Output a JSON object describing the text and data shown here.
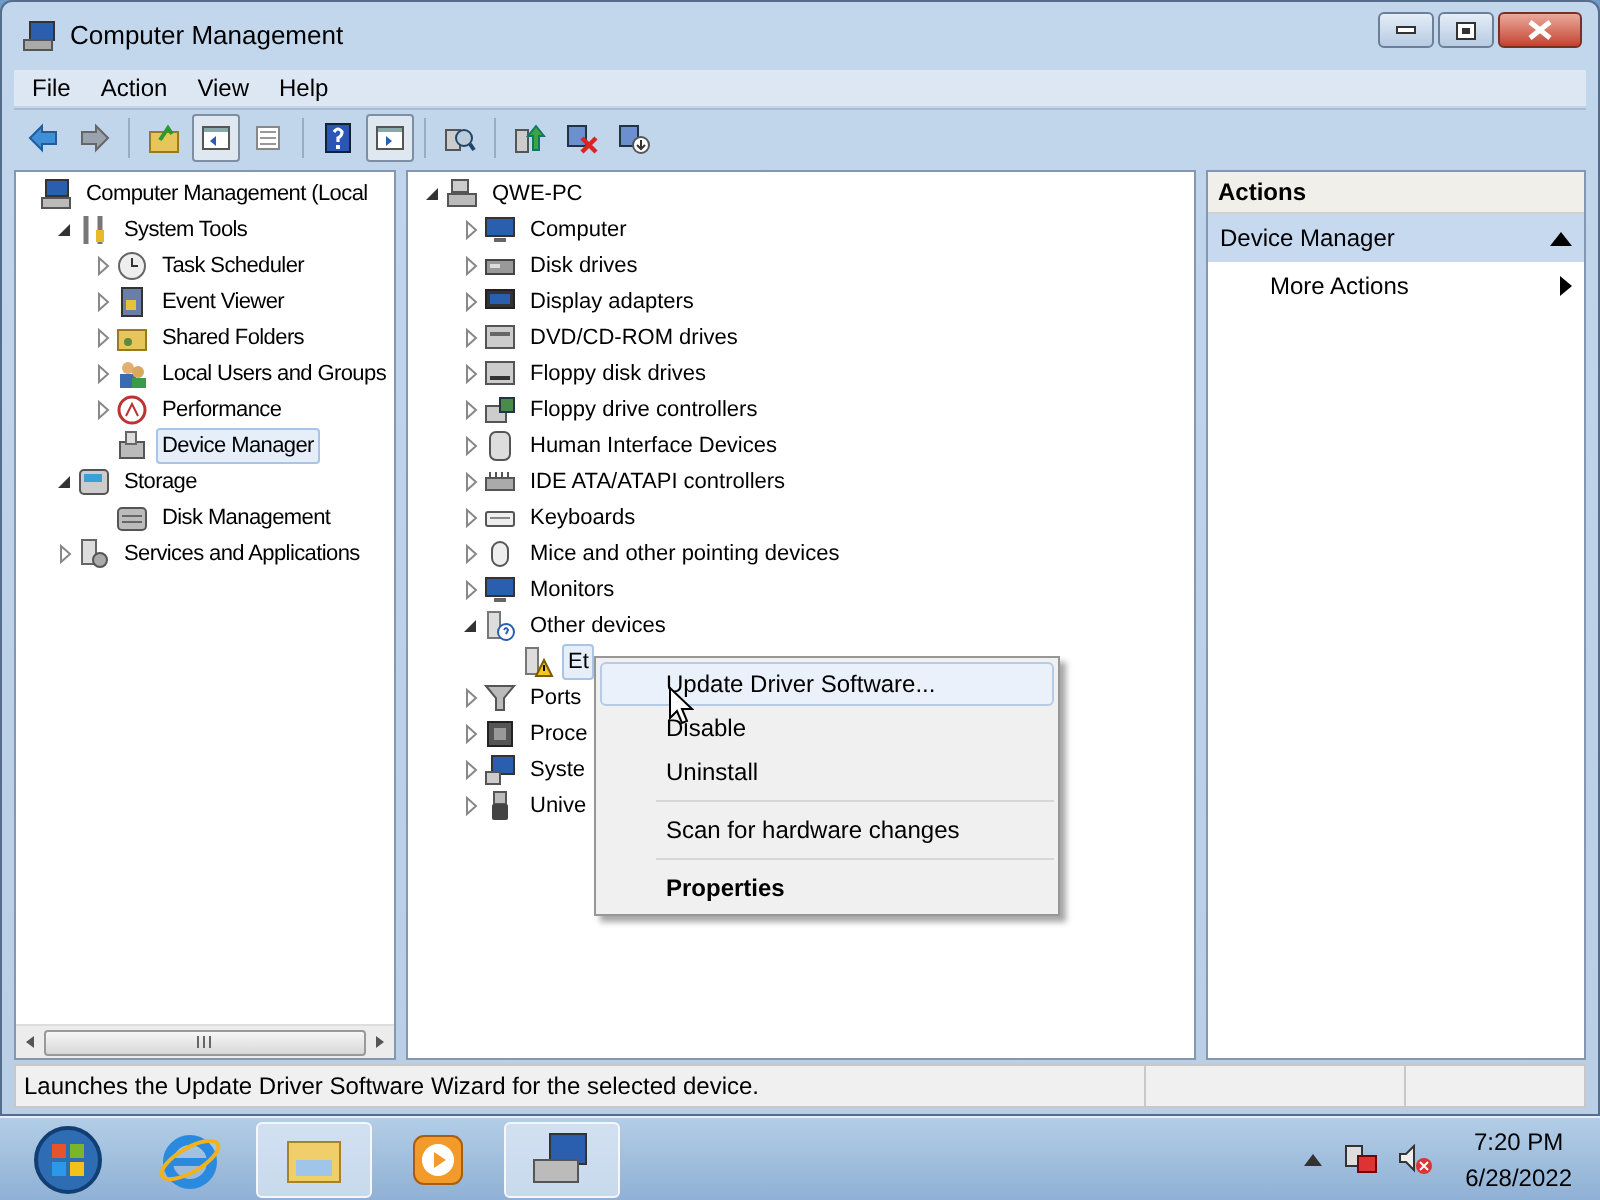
{
  "window": {
    "title": "Computer Management"
  },
  "menu": [
    "File",
    "Action",
    "View",
    "Help"
  ],
  "toolbar": [
    {
      "pressed": false
    },
    {
      "pressed": false
    },
    {
      "pressed": false
    },
    {
      "pressed": true
    },
    {
      "pressed": false
    },
    {
      "pressed": false
    },
    {
      "pressed": true
    },
    {
      "pressed": false
    },
    {
      "pressed": false
    },
    {
      "pressed": false
    },
    {
      "pressed": false
    }
  ],
  "console_tree": [
    {
      "label": "Computer Management (Local",
      "selected": false,
      "children": [
        {
          "label": "System Tools",
          "selected": false,
          "expanded": true,
          "children": [
            {
              "label": "Task Scheduler",
              "selected": false,
              "expanded": false
            },
            {
              "label": "Event Viewer",
              "selected": false,
              "expanded": false
            },
            {
              "label": "Shared Folders",
              "selected": false,
              "expanded": false
            },
            {
              "label": "Local Users and Groups",
              "selected": false,
              "expanded": false
            },
            {
              "label": "Performance",
              "selected": false,
              "expanded": false
            },
            {
              "label": "Device Manager",
              "selected": true
            }
          ]
        },
        {
          "label": "Storage",
          "selected": false,
          "expanded": true,
          "children": [
            {
              "label": "Disk Management",
              "selected": false
            }
          ]
        },
        {
          "label": "Services and Applications",
          "selected": false,
          "expanded": false
        }
      ]
    }
  ],
  "device_tree": [
    {
      "label": "QWE-PC",
      "selected": false,
      "expanded": true,
      "children": [
        {
          "label": "Computer",
          "selected": false,
          "expanded": false
        },
        {
          "label": "Disk drives",
          "selected": false,
          "expanded": false
        },
        {
          "label": "Display adapters",
          "selected": false,
          "expanded": false
        },
        {
          "label": "DVD/CD-ROM drives",
          "selected": false,
          "expanded": false
        },
        {
          "label": "Floppy disk drives",
          "selected": false,
          "expanded": false
        },
        {
          "label": "Floppy drive controllers",
          "selected": false,
          "expanded": false
        },
        {
          "label": "Human Interface Devices",
          "selected": false,
          "expanded": false
        },
        {
          "label": "IDE ATA/ATAPI controllers",
          "selected": false,
          "expanded": false
        },
        {
          "label": "Keyboards",
          "selected": false,
          "expanded": false
        },
        {
          "label": "Mice and other pointing devices",
          "selected": false,
          "expanded": false
        },
        {
          "label": "Monitors",
          "selected": false,
          "expanded": false
        },
        {
          "label": "Other devices",
          "selected": false,
          "expanded": true,
          "children": [
            {
              "label": "Et",
              "selected": true
            }
          ]
        },
        {
          "label": "Ports",
          "selected": false,
          "expanded": false
        },
        {
          "label": "Proce",
          "selected": false,
          "expanded": false
        },
        {
          "label": "Syste",
          "selected": false,
          "expanded": false
        },
        {
          "label": "Unive",
          "selected": false,
          "expanded": false
        }
      ]
    }
  ],
  "context_menu": [
    {
      "kind": "item",
      "label": "Update Driver Software...",
      "selected": true,
      "bold": false
    },
    {
      "kind": "item",
      "label": "Disable",
      "selected": false,
      "bold": false
    },
    {
      "kind": "item",
      "label": "Uninstall",
      "selected": false,
      "bold": false
    },
    {
      "kind": "separator"
    },
    {
      "kind": "item",
      "label": "Scan for hardware changes",
      "selected": false,
      "bold": false
    },
    {
      "kind": "separator"
    },
    {
      "kind": "item",
      "label": "Properties",
      "selected": false,
      "bold": true
    }
  ],
  "actions": {
    "title": "Actions",
    "section": {
      "label": "Device Manager",
      "expanded": true
    },
    "items": [
      {
        "label": "More Actions"
      }
    ]
  },
  "status_bar": "Launches the Update Driver Software Wizard for the selected device.",
  "taskbar": {
    "apps": [
      {
        "selected": false
      },
      {
        "selected": true
      },
      {
        "selected": false
      },
      {
        "selected": true
      }
    ],
    "time": "7:20 PM",
    "date": "6/28/2022"
  }
}
